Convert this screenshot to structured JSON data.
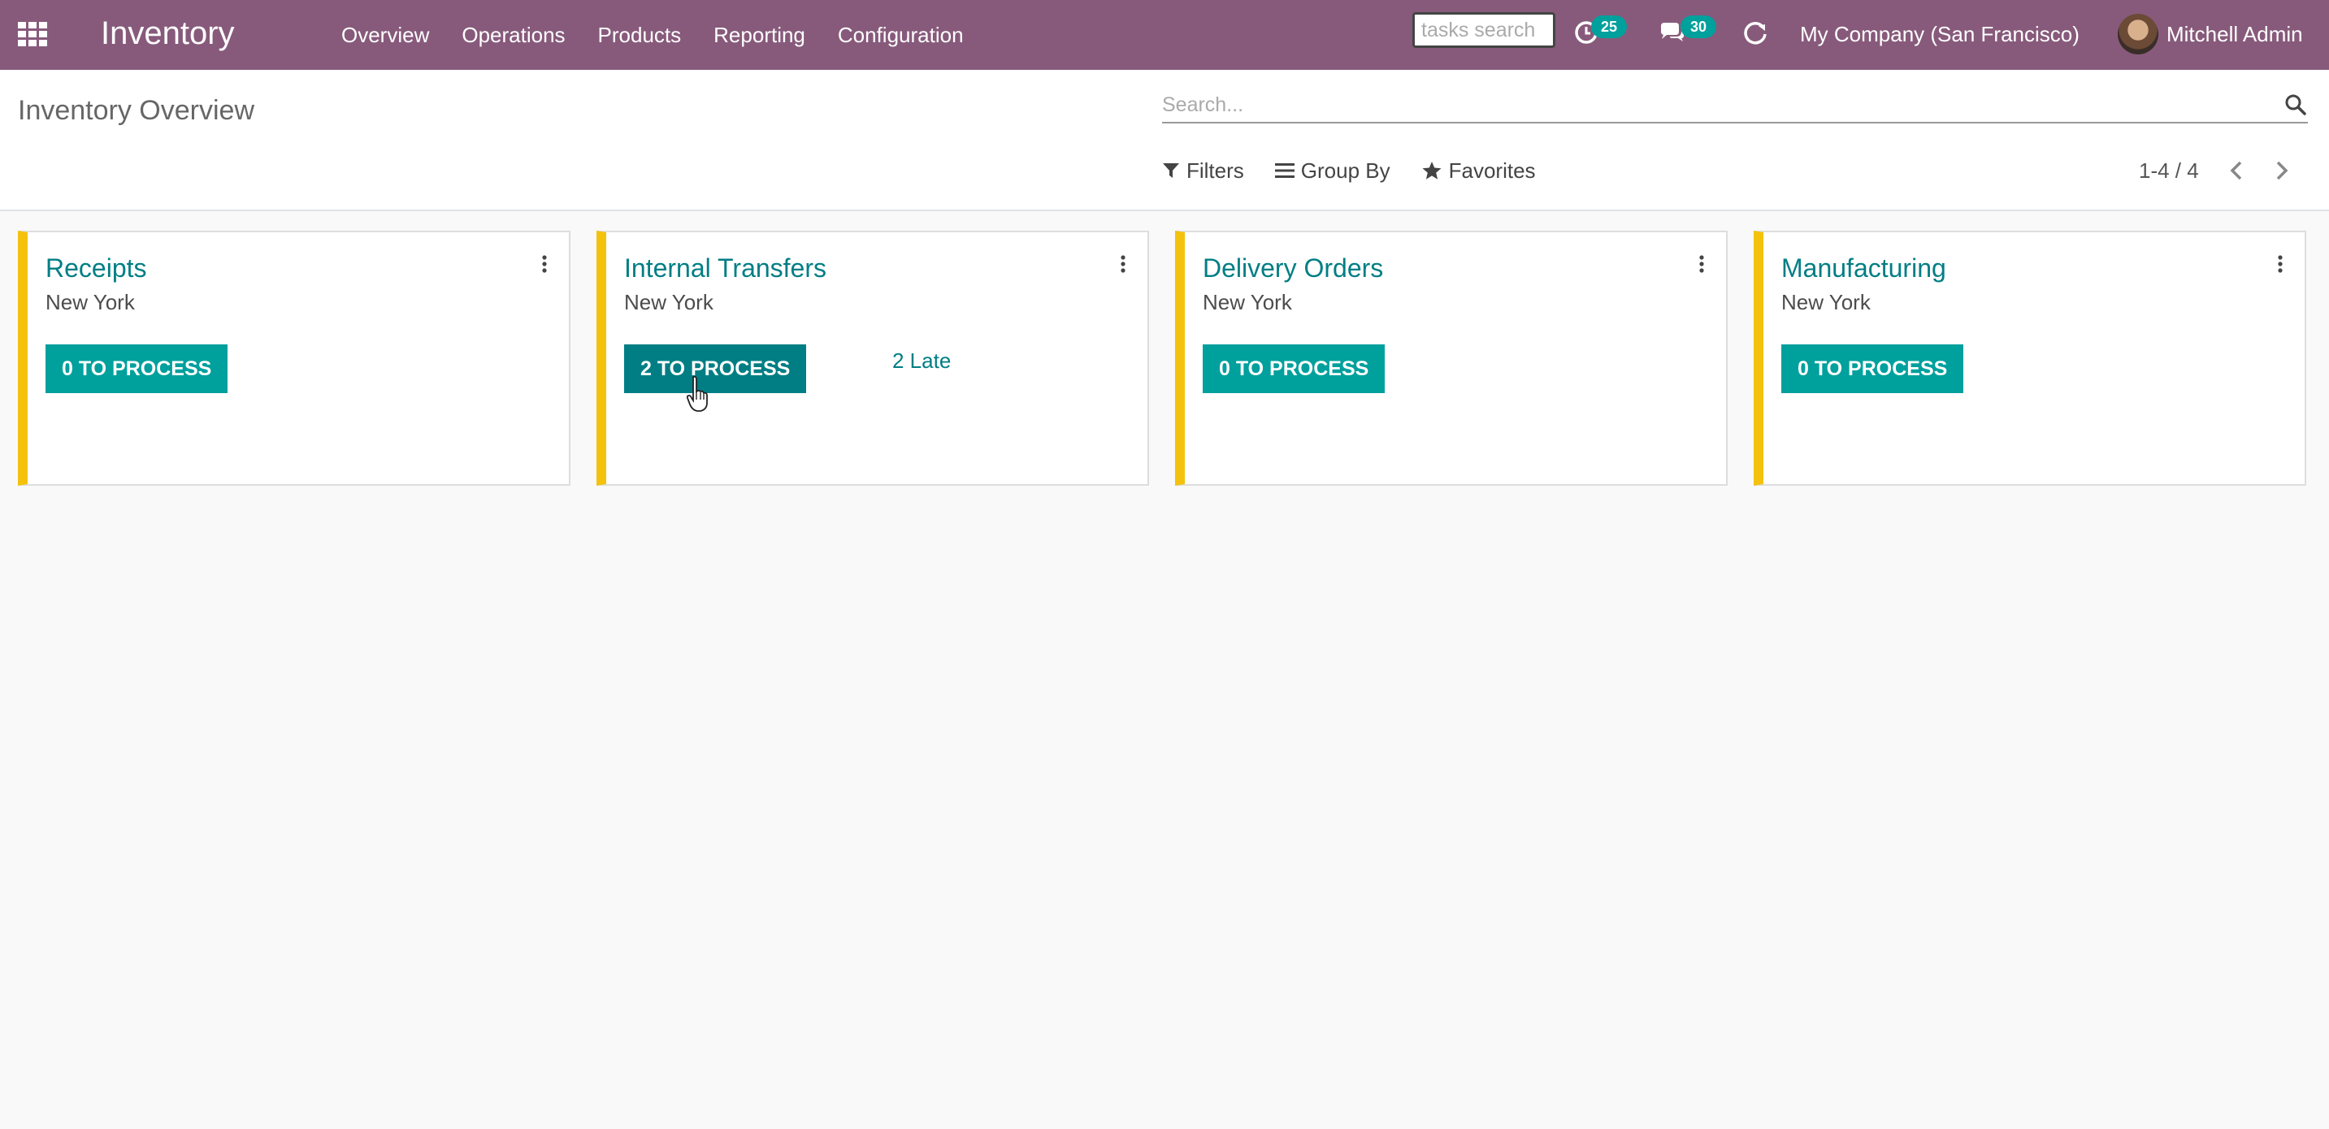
{
  "navbar": {
    "app_name": "Inventory",
    "menu": [
      "Overview",
      "Operations",
      "Products",
      "Reporting",
      "Configuration"
    ],
    "tasks_search_placeholder": "tasks search",
    "activity_count": "25",
    "messages_count": "30",
    "company": "My Company (San Francisco)",
    "user": "Mitchell Admin"
  },
  "control_panel": {
    "breadcrumb": "Inventory Overview",
    "search_placeholder": "Search...",
    "filters_label": "Filters",
    "group_by_label": "Group By",
    "favorites_label": "Favorites",
    "pager": "1-4 / 4"
  },
  "cards": [
    {
      "title": "Receipts",
      "subtitle": "New York",
      "button": "0 TO PROCESS",
      "late": ""
    },
    {
      "title": "Internal Transfers",
      "subtitle": "New York",
      "button": "2 TO PROCESS",
      "late": "2 Late"
    },
    {
      "title": "Delivery Orders",
      "subtitle": "New York",
      "button": "0 TO PROCESS",
      "late": ""
    },
    {
      "title": "Manufacturing",
      "subtitle": "New York",
      "button": "0 TO PROCESS",
      "late": ""
    }
  ],
  "colors": {
    "navbar": "#875a7b",
    "accent": "#00a09d",
    "accent_dark": "#017e84",
    "card_stripe": "#f4c20d"
  },
  "icons": [
    "apps-grid-icon",
    "activity-clock-icon",
    "chat-bubbles-icon",
    "refresh-icon",
    "search-icon",
    "filter-icon",
    "group-by-icon",
    "star-icon",
    "chevron-left-icon",
    "chevron-right-icon",
    "kebab-menu-icon"
  ]
}
